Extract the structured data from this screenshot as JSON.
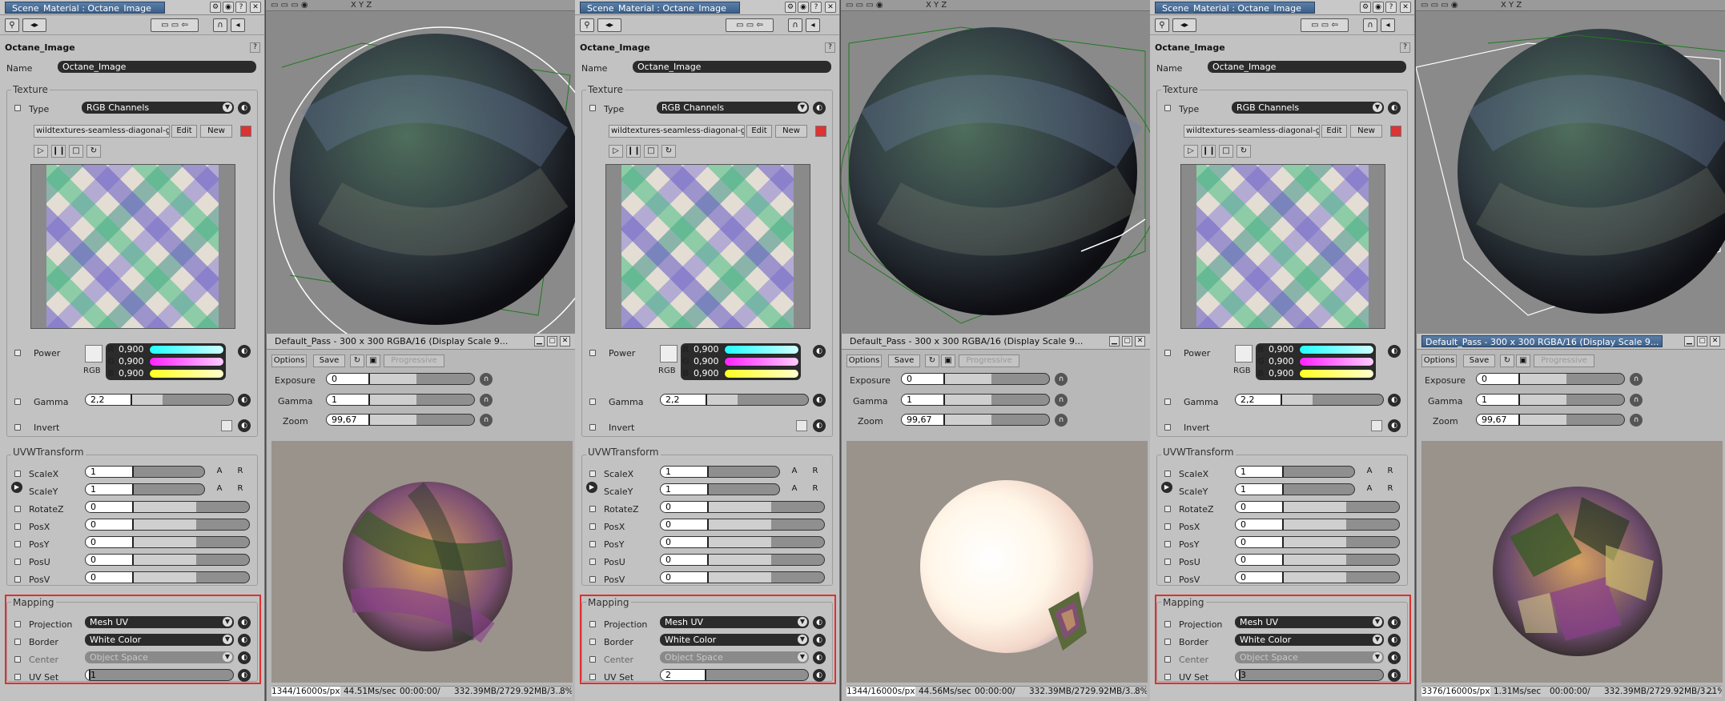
{
  "window_title": "Scene_Material : Octane_Image",
  "section_name": "Octane_Image",
  "name_label": "Name",
  "name_value": "Octane_Image",
  "texture": {
    "group": "Texture",
    "type_label": "Type",
    "type_value": "RGB Channels",
    "file": "wildtextures-seamless-diagonal-grid",
    "edit": "Edit",
    "new": "New",
    "power_label": "Power",
    "rgb": "RGB",
    "r_label": "R",
    "g_label": "G",
    "b_label": "B",
    "r_value": "0,900",
    "g_value": "0,900",
    "b_value": "0,900",
    "gamma_label": "Gamma",
    "gamma_value": "2,2",
    "invert_label": "Invert"
  },
  "uvw": {
    "group": "UVWTransform",
    "rows": [
      {
        "label": "ScaleX",
        "value": "1",
        "a": "A",
        "r": "R"
      },
      {
        "label": "ScaleY",
        "value": "1",
        "a": "A",
        "r": "R"
      },
      {
        "label": "RotateZ",
        "value": "0"
      },
      {
        "label": "PosX",
        "value": "0"
      },
      {
        "label": "PosY",
        "value": "0"
      },
      {
        "label": "PosU",
        "value": "0"
      },
      {
        "label": "PosV",
        "value": "0"
      }
    ]
  },
  "mapping": {
    "group": "Mapping",
    "projection_label": "Projection",
    "projection_value": "Mesh UV",
    "border_label": "Border",
    "border_value": "White Color",
    "center_label": "Center",
    "center_value": "Object Space",
    "uvset_label": "UV Set"
  },
  "panels": [
    {
      "uvset": "1",
      "uvset_fraction": 0.02
    },
    {
      "uvset": "2",
      "uvset_fraction": 0.3
    },
    {
      "uvset": "3",
      "uvset_fraction": 0.02
    }
  ],
  "viewport": {
    "axes": "X Y Z"
  },
  "render": {
    "title": "Default_Pass - 300 x 300 RGBA/16 (Display Scale 9...",
    "options": "Options",
    "save": "Save",
    "progressive": "Progressive",
    "exposure_label": "Exposure",
    "exposure_value": "0",
    "gamma_label": "Gamma",
    "gamma_value": "1",
    "zoom_label": "Zoom",
    "zoom_value": "99,67"
  },
  "render_status": [
    {
      "samples": "1344/16000s/px",
      "speed": "44.51Ms/sec",
      "time": "00:00:00/",
      "mem": "332.39MB/2729.92MB/3...",
      "pct": "8%"
    },
    {
      "samples": "1344/16000s/px",
      "speed": "44.56Ms/sec",
      "time": "00:00:00/",
      "mem": "332.39MB/2729.92MB/3...",
      "pct": "8%"
    },
    {
      "samples": "3376/16000s/px",
      "speed": "1.31Ms/sec",
      "time": "00:00:00/",
      "mem": "332.39MB/2729.92MB/3...",
      "pct": "21%"
    }
  ],
  "colors": {
    "accent": "#3b5f88",
    "highlight": "#e0302e",
    "field": "#2b2b2b"
  }
}
